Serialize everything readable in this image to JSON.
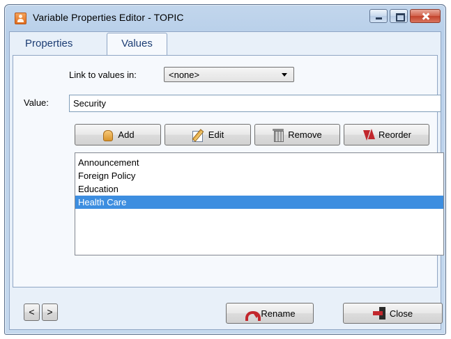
{
  "window": {
    "title": "Variable Properties Editor - TOPIC"
  },
  "tabs": [
    {
      "label": "Properties",
      "active": false
    },
    {
      "label": "Values",
      "active": true
    }
  ],
  "link": {
    "label": "Link to values in:",
    "selected": "<none>"
  },
  "value": {
    "label": "Value:",
    "input": "Security"
  },
  "buttons": {
    "add": "Add",
    "edit": "Edit",
    "remove": "Remove",
    "reorder": "Reorder"
  },
  "list": {
    "items": [
      "Announcement",
      "Foreign Policy",
      "Education",
      "Health Care"
    ],
    "selected_index": 3
  },
  "footer": {
    "prev": "<",
    "next": ">",
    "rename": "Rename",
    "close": "Close"
  },
  "colors": {
    "selection": "#3d8ee0",
    "tab_text": "#1c3d74",
    "close_button": "#d2624c"
  },
  "icons": [
    "app-icon",
    "minimize-icon",
    "maximize-icon",
    "close-icon",
    "add-hand-icon",
    "edit-icon",
    "trash-icon",
    "reorder-arrows-icon",
    "rename-arrow-icon",
    "exit-door-icon"
  ]
}
